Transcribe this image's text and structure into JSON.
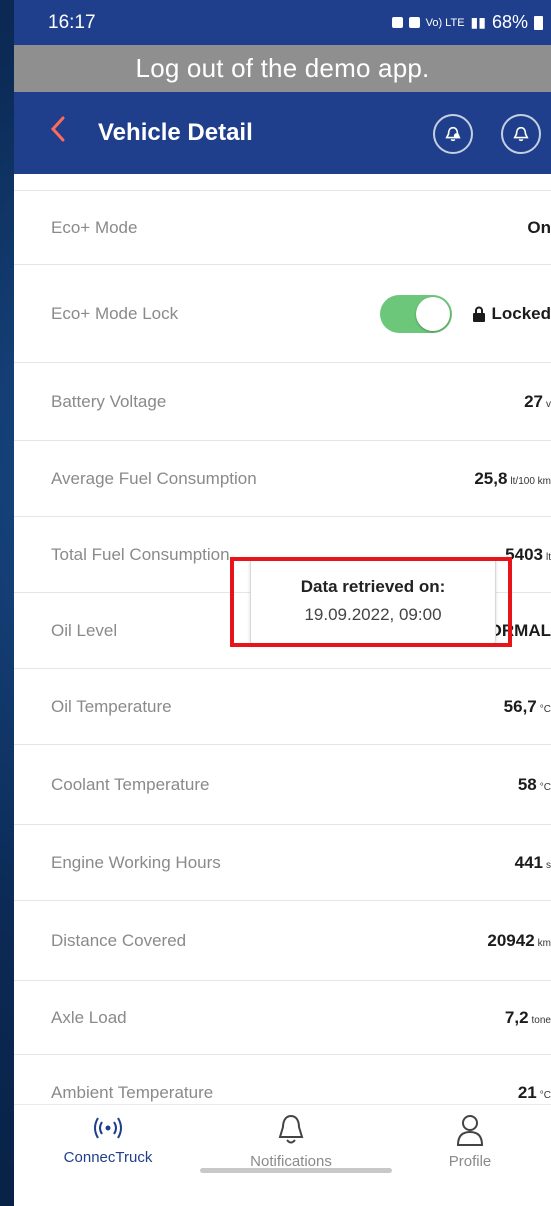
{
  "status_bar": {
    "time": "16:17",
    "signal_text": "Vo) LTE",
    "battery": "68%"
  },
  "banner": {
    "text": "Log out of the demo app."
  },
  "header": {
    "back_icon": "chevron-left",
    "title": "Vehicle Detail",
    "buttons": [
      "alarm-bell-icon",
      "bell-icon"
    ]
  },
  "rows": [
    {
      "label": "Eco+ Mode",
      "value": "On"
    },
    {
      "label": "Eco+ Mode Lock",
      "toggle_on": true,
      "value": "Locked"
    },
    {
      "label": "Battery Voltage",
      "value": "27",
      "unit": "v"
    },
    {
      "label": "Average Fuel Consumption",
      "value": "25,8",
      "unit": "lt/100 km"
    },
    {
      "label": "Total Fuel Consumption",
      "value": "5403",
      "unit": "lt"
    },
    {
      "label": "Oil Level",
      "value": "ORMAL"
    },
    {
      "label": "Oil Temperature",
      "value": "56,7",
      "unit": "°C"
    },
    {
      "label": "Coolant Temperature",
      "value": "58",
      "unit": "°C"
    },
    {
      "label": "Engine Working Hours",
      "value": "441",
      "unit": "s"
    },
    {
      "label": "Distance Covered",
      "value": "20942",
      "unit": "km"
    },
    {
      "label": "Axle Load",
      "value": "7,2",
      "unit": "tone"
    },
    {
      "label": "Ambient Temperature",
      "value": "21",
      "unit": "°C"
    }
  ],
  "tooltip": {
    "title": "Data retrieved on:",
    "date": "19.09.2022, 09:00"
  },
  "tabs": [
    {
      "label": "ConnecTruck",
      "icon": "broadcast-icon",
      "active": true
    },
    {
      "label": "Notifications",
      "icon": "bell-icon",
      "active": false
    },
    {
      "label": "Profile",
      "icon": "user-icon",
      "active": false
    }
  ],
  "colors": {
    "primary": "#1f3f8c",
    "banner": "#8f8f8f",
    "accent_back": "#ff6b5a",
    "toggle_on": "#6cc77a",
    "normal_status": "#5fbf8f",
    "highlight": "#e8141b"
  }
}
